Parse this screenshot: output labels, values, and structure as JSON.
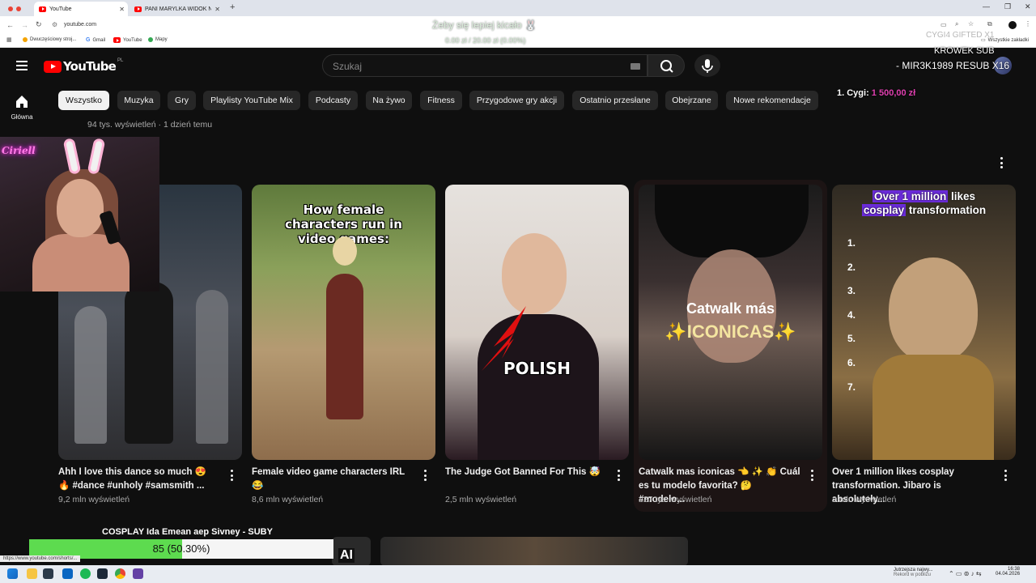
{
  "browser": {
    "tabs": [
      {
        "label": "YouTube"
      },
      {
        "label": "PANI MARYLKA WIDOK NA BUDO..."
      }
    ],
    "url": "youtube.com",
    "bookmarks": [
      "Dwuczęściowy stroj...",
      "Gmail",
      "YouTube",
      "Mapy"
    ],
    "all_bookmarks": "Wszystkie zakładki",
    "status_url": "https://www.youtube.com/shorts/..."
  },
  "overlay": {
    "top_center": "Żeby się lepiej kicało 🐰",
    "top_center_sub": "0.00 zł / 20.00 zł (0.00%)",
    "gift_line": "CYGI4  GIFTED X1",
    "sub_line": "KROWEK  SUB",
    "resub_line": "- MIR3K1989  RESUB X16",
    "leader_rank": "1. Cygi:",
    "leader_amount": "1 500,00 zł",
    "webcam_neon": "Ciriell",
    "progress_title": "COSPLAY Ida Emean aep Sivney - SUBY",
    "progress_value": 0.503,
    "progress_label": "85 (50.30%)"
  },
  "youtube": {
    "logo": "YouTube",
    "logo_country": "PL",
    "search_placeholder": "Szukaj",
    "sidebar_home": "Główna",
    "chips": [
      "Wszystko",
      "Muzyka",
      "Gry",
      "Playlisty YouTube Mix",
      "Podcasty",
      "Na żywo",
      "Fitness",
      "Przygodowe gry akcji",
      "Ostatnio przesłane",
      "Obejrzane",
      "Nowe rekomendacje"
    ],
    "prev_meta": "94 tys. wyświetleń · 1 dzień temu",
    "shorts": [
      {
        "title": "Ahh I love this dance so much 😍 🔥 #dance #unholy #samsmith ...",
        "views": "9,2 mln wyświetleń"
      },
      {
        "title": "Female video game characters IRL 😂",
        "views": "8,6 mln wyświetleń",
        "overlay_text": "How female characters run in video games:"
      },
      {
        "title": "The Judge Got Banned For This 🤯",
        "views": "2,5 mln wyświetleń",
        "overlay_text": "POLISH"
      },
      {
        "title": "Catwalk mas iconicas 👈 ✨ 👏 Cuál es tu modelo favorita? 🤔 #modelo...",
        "views": "227 tys. wyświetleń",
        "overlay_line1": "Catwalk más",
        "overlay_line2": "✨ICONICAS✨"
      },
      {
        "title": "Over 1 million likes cosplay transformation. Jibaro is absolutely...",
        "views": "2 mln wyświetleń",
        "overlay_hl1": "Over 1 million",
        "overlay_rest1": " likes",
        "overlay_hl2": "cosplay",
        "overlay_rest2": " transformation",
        "list": [
          "1.",
          "2.",
          "3.",
          "4.",
          "5.",
          "6.",
          "7."
        ]
      }
    ]
  },
  "taskbar": {
    "weather": "Jutrzejsza najwy...",
    "weather_sub": "Rekord w pobliżu",
    "time": "16:38",
    "date": "04.04.2026"
  }
}
